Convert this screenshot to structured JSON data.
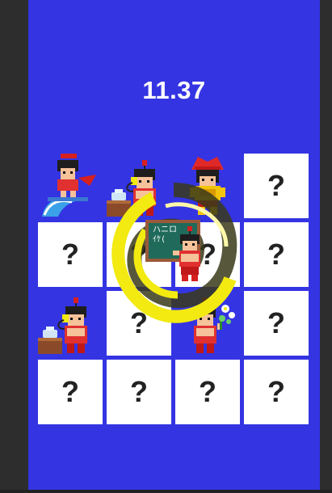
{
  "timer": "11.37",
  "hidden_symbol": "?",
  "board_color": "#3434e3",
  "tiles": [
    {
      "row": 0,
      "col": 0,
      "state": "revealed",
      "icon": "spartan-surfer-icon"
    },
    {
      "row": 0,
      "col": 1,
      "state": "revealed",
      "icon": "spartan-phone-call-icon"
    },
    {
      "row": 0,
      "col": 2,
      "state": "revealed",
      "icon": "spartan-golden-armor-icon"
    },
    {
      "row": 0,
      "col": 3,
      "state": "hidden"
    },
    {
      "row": 1,
      "col": 0,
      "state": "hidden"
    },
    {
      "row": 1,
      "col": 1,
      "state": "hidden"
    },
    {
      "row": 1,
      "col": 2,
      "state": "hidden"
    },
    {
      "row": 1,
      "col": 3,
      "state": "hidden"
    },
    {
      "row": 2,
      "col": 0,
      "state": "revealed",
      "icon": "spartan-phone-call-icon"
    },
    {
      "row": 2,
      "col": 1,
      "state": "hidden"
    },
    {
      "row": 2,
      "col": 2,
      "state": "revealed",
      "icon": "spartan-flower-icon"
    },
    {
      "row": 2,
      "col": 3,
      "state": "hidden"
    },
    {
      "row": 3,
      "col": 0,
      "state": "hidden"
    },
    {
      "row": 3,
      "col": 1,
      "state": "hidden"
    },
    {
      "row": 3,
      "col": 2,
      "state": "hidden"
    },
    {
      "row": 3,
      "col": 3,
      "state": "hidden"
    }
  ],
  "overlay": {
    "icon": "spartan-teacher-chalkboard-icon",
    "chalkboard_text_line1": "ハニロ",
    "chalkboard_text_line2": "ｲｹ(",
    "swirl_color": "#f2ea10"
  }
}
